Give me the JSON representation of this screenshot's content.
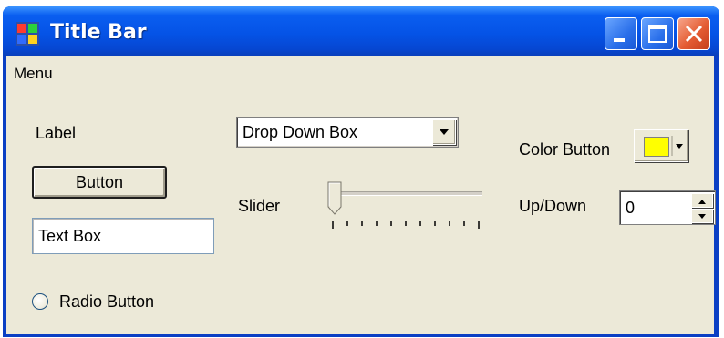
{
  "window": {
    "title": "Title Bar",
    "controls": [
      "minimize-icon",
      "maximize-icon",
      "close-icon"
    ]
  },
  "menu": {
    "items": [
      {
        "label": "Menu"
      }
    ]
  },
  "controls": {
    "label_text": "Label",
    "button_label": "Button",
    "textbox_value": "Text Box",
    "radio_label": "Radio Button",
    "radio_checked": false,
    "dropdown_value": "Drop Down Box",
    "slider_label": "Slider",
    "slider_value": 0,
    "slider_ticks": 11,
    "color_button_label": "Color Button",
    "color_value": "#ffff00",
    "updown_label": "Up/Down",
    "updown_value": "0"
  },
  "colors": {
    "titlebar": "#0553e6",
    "client": "#ece9d8",
    "close_button": "#e45b32"
  }
}
